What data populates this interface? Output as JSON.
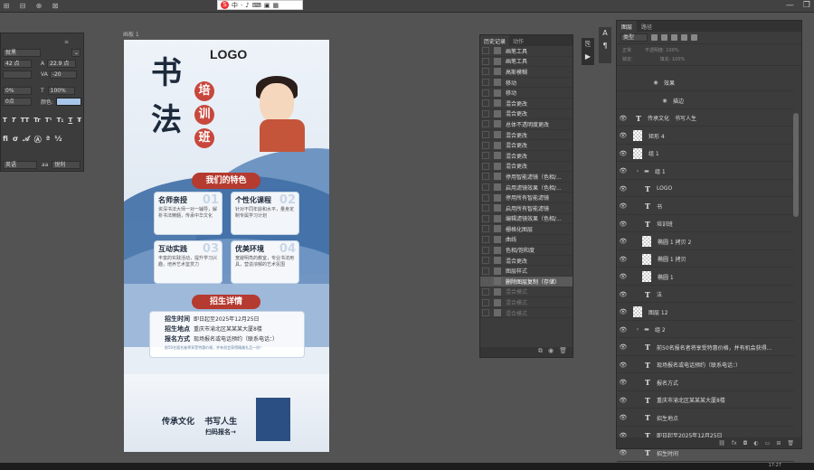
{
  "ime": {
    "brand": "S",
    "lang": "中"
  },
  "canvas": {
    "tab": "画板 1"
  },
  "character_panel": {
    "font_name": "就黑",
    "size": "42 点",
    "leading": "22.9 点",
    "tracking": "-20",
    "scale_v": "0%",
    "scale_h": "100%",
    "color_label": "颜色:",
    "baseline": "0点",
    "language": "英语",
    "antialias": "锐利",
    "glyph_buttons": [
      "T",
      "T",
      "TT",
      "Tr",
      "T¹",
      "T₁",
      "T",
      "Ŧ"
    ]
  },
  "poster": {
    "logo": "LOGO",
    "title_chars": [
      "书",
      "法"
    ],
    "seal_chars": [
      "培",
      "训",
      "班"
    ],
    "features_banner": "我们的特色",
    "cards": [
      {
        "title": "名师亲授",
        "num": "01",
        "text": "资深书法大师一对一辅导，解析书法精髓，传承中华文化"
      },
      {
        "title": "个性化课程",
        "num": "02",
        "text": "针对不同年龄和水平，量身定制专属学习计划"
      },
      {
        "title": "互动实践",
        "num": "03",
        "text": "丰富的实践活动，提升学习兴趣，培养艺术鉴赏力"
      },
      {
        "title": "优美环境",
        "num": "04",
        "text": "宽敞明亮的教室，专业书法用具，营造浓郁的艺术氛围"
      }
    ],
    "recruit_banner": "招生详情",
    "recruit": [
      {
        "label": "招生时间",
        "value": "即日起至2025年12月25日"
      },
      {
        "label": "招生地点",
        "value": "重庆市渝北区某某某大厦8楼"
      },
      {
        "label": "报名方式",
        "value": "现场报名或电话预约（联系电话：）"
      }
    ],
    "recruit_note": "前50名报名者将享受特惠价格，并有机会获得精美礼品一份！",
    "slogan": "传承文化 书写人生",
    "scan": "扫码报名→"
  },
  "history": {
    "tabs": [
      "历史记录",
      "动作"
    ],
    "items": [
      {
        "label": "画笔工具",
        "state": "normal"
      },
      {
        "label": "画笔工具",
        "state": "normal"
      },
      {
        "label": "高斯模糊",
        "state": "normal"
      },
      {
        "label": "移动",
        "state": "normal"
      },
      {
        "label": "移动",
        "state": "normal"
      },
      {
        "label": "混合更改",
        "state": "normal"
      },
      {
        "label": "混合更改",
        "state": "normal"
      },
      {
        "label": "总体不透明度更改",
        "state": "normal"
      },
      {
        "label": "混合更改",
        "state": "normal"
      },
      {
        "label": "混合更改",
        "state": "normal"
      },
      {
        "label": "混合更改",
        "state": "normal"
      },
      {
        "label": "混合更改",
        "state": "normal"
      },
      {
        "label": "停用智能滤镜（色相/...",
        "state": "normal"
      },
      {
        "label": "启用滤镜效果（色相/...",
        "state": "normal"
      },
      {
        "label": "停用所有智能滤镜",
        "state": "normal"
      },
      {
        "label": "启用所有智能滤镜",
        "state": "normal"
      },
      {
        "label": "编辑滤镜效果（色相/...",
        "state": "normal"
      },
      {
        "label": "栅格化图层",
        "state": "normal"
      },
      {
        "label": "曲线",
        "state": "normal"
      },
      {
        "label": "色相/饱和度",
        "state": "normal"
      },
      {
        "label": "混合更改",
        "state": "normal"
      },
      {
        "label": "图层样式",
        "state": "normal"
      },
      {
        "label": "删除图层复制（存储）",
        "state": "selected"
      },
      {
        "label": "混合模式",
        "state": "dim"
      },
      {
        "label": "混合模式",
        "state": "dim"
      },
      {
        "label": "混合模式",
        "state": "dim"
      }
    ]
  },
  "layers": {
    "tabs": [
      "图层",
      "路径"
    ],
    "filter_label": "类型",
    "opts_line1": "正常　　　不透明度: 100%",
    "opts_line2": "锁定:　　　　　　填充: 100%",
    "items": [
      {
        "label": "效果",
        "type": "effect",
        "eye": false,
        "indent": 2
      },
      {
        "label": "描边",
        "type": "effect",
        "eye": false,
        "indent": 3
      },
      {
        "label": "传承文化　书写人生",
        "type": "text",
        "eye": true,
        "indent": 0
      },
      {
        "label": "矩形 4",
        "type": "pixel",
        "eye": true,
        "indent": 0
      },
      {
        "label": "组 1",
        "type": "pixel",
        "eye": true,
        "indent": 0
      },
      {
        "label": "组 1",
        "type": "group",
        "eye": true,
        "indent": 0
      },
      {
        "label": "LOGO",
        "type": "text",
        "eye": true,
        "indent": 1
      },
      {
        "label": "书",
        "type": "text",
        "eye": true,
        "indent": 1
      },
      {
        "label": "培训班",
        "type": "text",
        "eye": true,
        "indent": 1
      },
      {
        "label": "椭圆 1 拷贝 2",
        "type": "pixel",
        "eye": true,
        "indent": 1
      },
      {
        "label": "椭圆 1 拷贝",
        "type": "pixel",
        "eye": true,
        "indent": 1
      },
      {
        "label": "椭圆 1",
        "type": "pixel",
        "eye": true,
        "indent": 1
      },
      {
        "label": "法",
        "type": "text",
        "eye": true,
        "indent": 1
      },
      {
        "label": "图层 12",
        "type": "pixel",
        "eye": true,
        "indent": 0
      },
      {
        "label": "组 2",
        "type": "group",
        "eye": true,
        "indent": 0
      },
      {
        "label": "前50名报名者将享受特惠价格，并有机会获得...",
        "type": "text",
        "eye": true,
        "indent": 1
      },
      {
        "label": "现场报名或电话预约（联系电话：）",
        "type": "text",
        "eye": true,
        "indent": 1
      },
      {
        "label": "报名方式",
        "type": "text",
        "eye": true,
        "indent": 1
      },
      {
        "label": "重庆市渝北区某某某大厦8楼",
        "type": "text",
        "eye": true,
        "indent": 1
      },
      {
        "label": "招生地点",
        "type": "text",
        "eye": true,
        "indent": 1
      },
      {
        "label": "即日起至2025年12月25日",
        "type": "text",
        "eye": true,
        "indent": 1
      },
      {
        "label": "招生时间",
        "type": "text",
        "eye": true,
        "indent": 1
      }
    ],
    "footer_icons": [
      "link",
      "fx",
      "mask",
      "adjust",
      "folder",
      "new",
      "trash"
    ]
  },
  "status": {
    "time": "17:27"
  }
}
